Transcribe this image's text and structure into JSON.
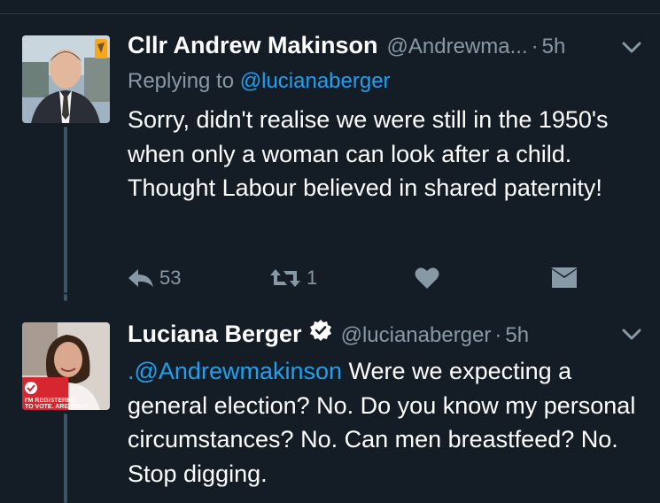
{
  "tweets": [
    {
      "name": "Cllr Andrew Makinson",
      "handle": "@Andrewma...",
      "separator": "·",
      "time": "5h",
      "replying_prefix": "Replying to",
      "replying_to": "@lucianaberger",
      "text": "Sorry, didn't realise we were still in the 1950's when only a woman can look after a child. Thought Labour believed in shared paternity!",
      "reply_count": "53",
      "retweet_count": "1",
      "avatar_badge_color": "#f6a81c"
    },
    {
      "name": "Luciana Berger",
      "verified": true,
      "handle": "@lucianaberger",
      "separator": "·",
      "time": "5h",
      "mention": ".@Andrewmakinson",
      "text": " Were we expecting a general election? No. Do you know my personal circumstances? No. Can men breastfeed? No. Stop digging.",
      "avatar_badge_line1": "I'M REGISTERED",
      "avatar_badge_line2": "TO VOTE.",
      "avatar_badge_line3": "ARE YOU?",
      "avatar_badge_color": "#d6262f"
    }
  ],
  "colors": {
    "background": "#141d26",
    "link": "#1da1f2",
    "muted": "#8899a6",
    "thread": "#3d5466"
  }
}
